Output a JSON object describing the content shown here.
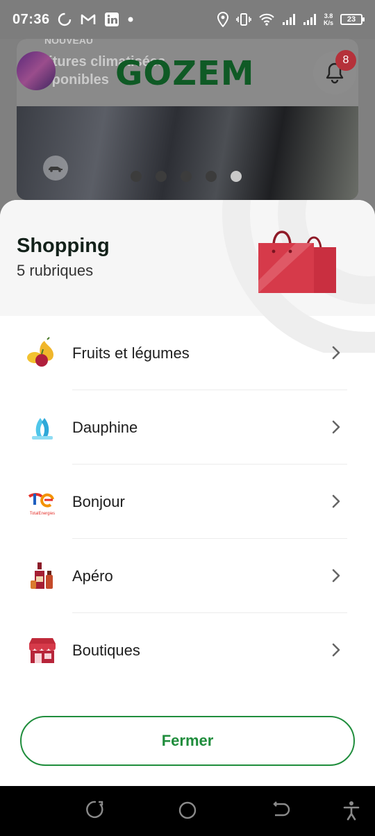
{
  "status_bar": {
    "time": "07:36",
    "net_speed_value": "3.8",
    "net_speed_unit": "K/s",
    "battery": "23",
    "icons": [
      "loading-icon",
      "gmail-icon",
      "linkedin-icon",
      "dot-icon",
      "location-icon",
      "vibrate-icon",
      "wifi-icon",
      "signal-icon",
      "signal-icon",
      "battery-icon"
    ]
  },
  "background_app": {
    "logo": "GOZEM",
    "banner_tag": "NOUVEAU",
    "banner_caption_line1": "oitures climatisées",
    "banner_caption_line2": "isponibles",
    "notification_count": "8",
    "carousel_dots": 5,
    "carousel_active_index": 4
  },
  "sheet": {
    "title": "Shopping",
    "subtitle": "5 rubriques",
    "items": [
      {
        "label": "Fruits et légumes",
        "icon": "fruits-icon"
      },
      {
        "label": "Dauphine",
        "icon": "dolphins-icon"
      },
      {
        "label": "Bonjour",
        "icon": "totalenergies-icon"
      },
      {
        "label": "Apéro",
        "icon": "bottles-icon"
      },
      {
        "label": "Boutiques",
        "icon": "shop-icon"
      }
    ],
    "total_energies_text": "TotalEnergies",
    "close_label": "Fermer"
  },
  "colors": {
    "accent_green": "#1f8d3c",
    "logo_green": "#0f5a25",
    "badge_red": "#b5313a",
    "bag_red": "#d63a4a"
  }
}
